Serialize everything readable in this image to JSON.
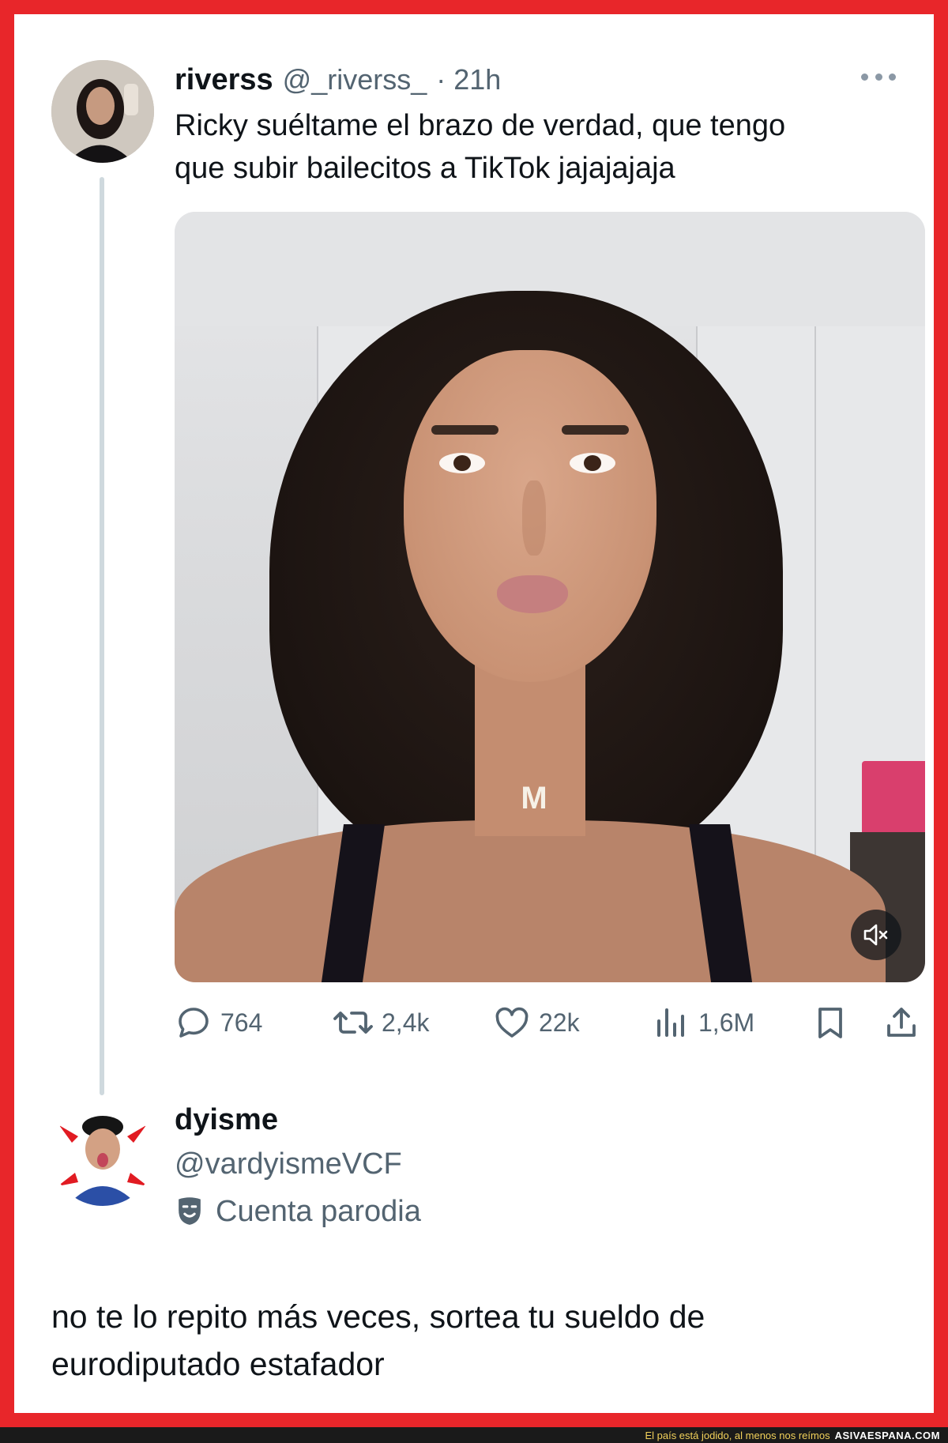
{
  "tweet": {
    "author_name": "riverss",
    "author_handle": "@_riverss_",
    "time": "· 21h",
    "text_line1": "Ricky suéltame el brazo de verdad,  que tengo",
    "text_line2": "que subir bailecitos a TikTok jajajajaja",
    "media_necklace_letter": "M",
    "stats": {
      "replies": "764",
      "retweets": "2,4k",
      "likes": "22k",
      "views": "1,6M"
    }
  },
  "reply": {
    "author_name": "dyisme",
    "author_handle": "@vardyismeVCF",
    "account_label": "Cuenta parodia",
    "text_line1": "no te lo repito más veces, sortea tu sueldo de",
    "text_line2": "eurodiputado estafador"
  },
  "footer": {
    "caption": "El país está jodido, al menos nos reímos",
    "site": "ASIVAESPANA.COM"
  },
  "colors": {
    "frame": "#e8262a",
    "text_primary": "#0f1419",
    "text_secondary": "#536471",
    "thread_line": "#cfd9de"
  },
  "icons": [
    "more-icon",
    "reply-icon",
    "retweet-icon",
    "like-icon",
    "views-icon",
    "bookmark-icon",
    "share-icon",
    "mute-icon",
    "parody-mask-icon"
  ]
}
